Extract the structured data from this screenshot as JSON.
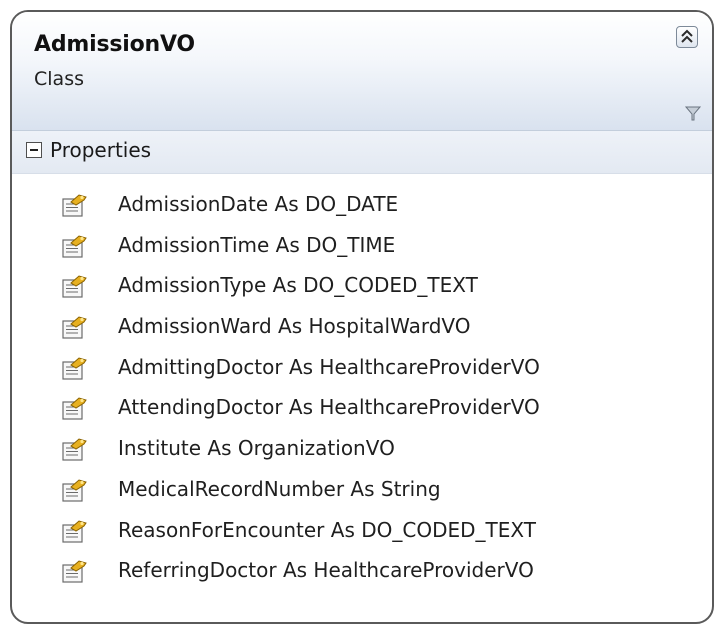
{
  "class_shape": {
    "name": "AdmissionVO",
    "kind": "Class",
    "collapse_icon": "double-chevron-up-icon",
    "filter_icon": "filter-icon"
  },
  "compartment": {
    "title": "Properties",
    "expander_icon": "minus-box-icon",
    "member_icon": "property-icon"
  },
  "properties": [
    "AdmissionDate As DO_DATE",
    "AdmissionTime As DO_TIME",
    "AdmissionType As DO_CODED_TEXT",
    "AdmissionWard As HospitalWardVO",
    "AdmittingDoctor As HealthcareProviderVO",
    "AttendingDoctor As HealthcareProviderVO",
    "Institute As OrganizationVO",
    "MedicalRecordNumber As String",
    "ReasonForEncounter As DO_CODED_TEXT",
    "ReferringDoctor As HealthcareProviderVO"
  ],
  "colors": {
    "border": "#5a5a5a",
    "header_gradient_end": "#d9e2ef",
    "section_header": "#e8edf5"
  }
}
